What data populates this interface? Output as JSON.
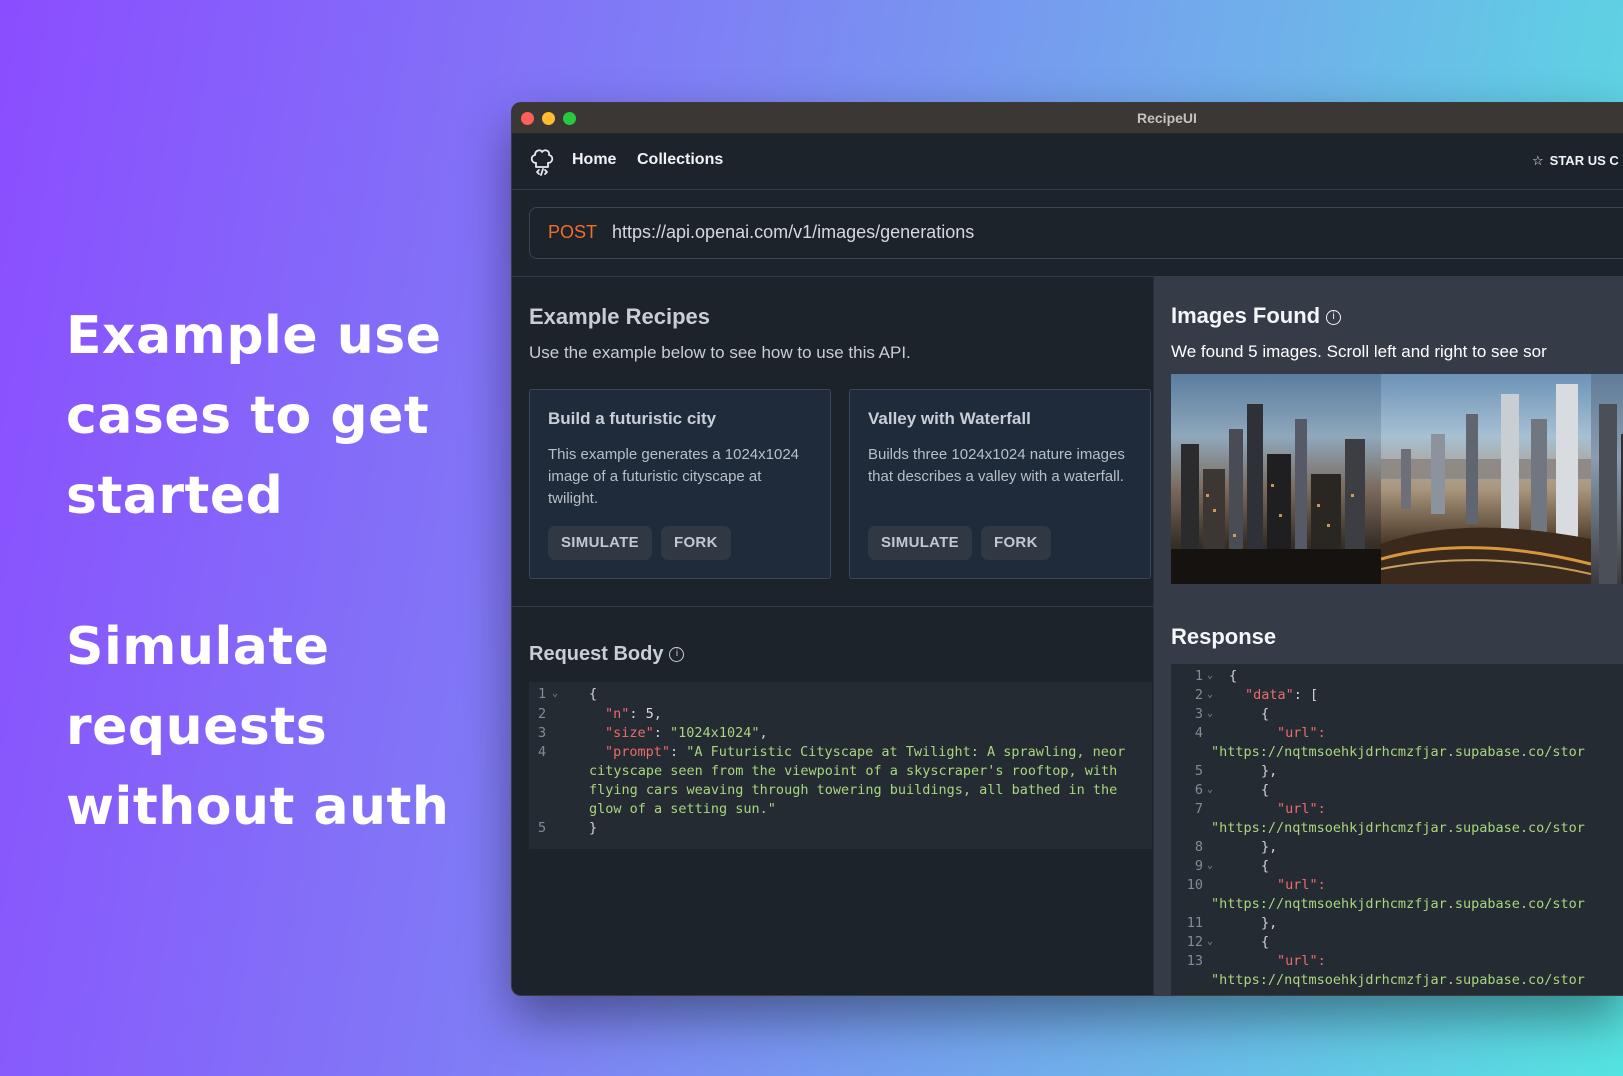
{
  "promo": {
    "block1": [
      "Example use",
      "cases to get",
      "started"
    ],
    "block2": [
      "Simulate",
      "requests",
      "without auth"
    ]
  },
  "window": {
    "title": "RecipeUI"
  },
  "nav": {
    "logo_icon": "chef-hat-icon",
    "home": "Home",
    "collections": "Collections",
    "star_icon": "star-icon",
    "star_label": "STAR US C"
  },
  "request": {
    "method": "POST",
    "url": "https://api.openai.com/v1/images/generations"
  },
  "recipes": {
    "title": "Example Recipes",
    "subtitle": "Use the example below to see how to use this API.",
    "cards": [
      {
        "title": "Build a futuristic city",
        "description": "This example generates a 1024x1024 image of a futuristic cityscape at twilight.",
        "simulate": "SIMULATE",
        "fork": "FORK"
      },
      {
        "title": "Valley with Waterfall",
        "description": "Builds three 1024x1024 nature images that describes a valley with a waterfall.",
        "simulate": "SIMULATE",
        "fork": "FORK"
      }
    ]
  },
  "request_body": {
    "title": "Request Body",
    "info_icon": "info-icon",
    "line_numbers": [
      "1",
      "2",
      "3",
      "4",
      "5"
    ],
    "lines": {
      "l1": "{",
      "n_key": "\"n\"",
      "n_val": "5",
      "size_key": "\"size\"",
      "size_val": "\"1024x1024\"",
      "prompt_key": "\"prompt\"",
      "prompt_val_1": "\"A Futuristic Cityscape at Twilight: A sprawling, neor",
      "prompt_val_2": "cityscape seen from the viewpoint of a skyscraper's rooftop, with",
      "prompt_val_3": "flying cars weaving through towering buildings, all bathed in the",
      "prompt_val_4": "glow of a setting sun.\"",
      "l5": "}"
    }
  },
  "images": {
    "title": "Images Found",
    "info_icon": "info-icon",
    "subtitle": "We found 5 images. Scroll left and right to see sor"
  },
  "response": {
    "title": "Response",
    "line_numbers": [
      "1",
      "2",
      "3",
      "4",
      "5",
      "6",
      "7",
      "8",
      "9",
      "10",
      "11",
      "12",
      "13"
    ],
    "open_brace": "{",
    "data_key": "\"data\"",
    "open_bracket": "[",
    "obj_open": "{",
    "obj_close": "},",
    "url_key": "\"url\":",
    "url_val": "\"https://nqtmsoehkjdrhcmzfjar.supabase.co/stor",
    "url_val_last": "\"https://nqtmsoehkjdrhcmzfjar.supabase.co/stor"
  },
  "colors": {
    "method": "#f06d2c",
    "json_key": "#ec6b6b",
    "json_string": "#a8d67d",
    "accent_tab": "#ffa000"
  }
}
